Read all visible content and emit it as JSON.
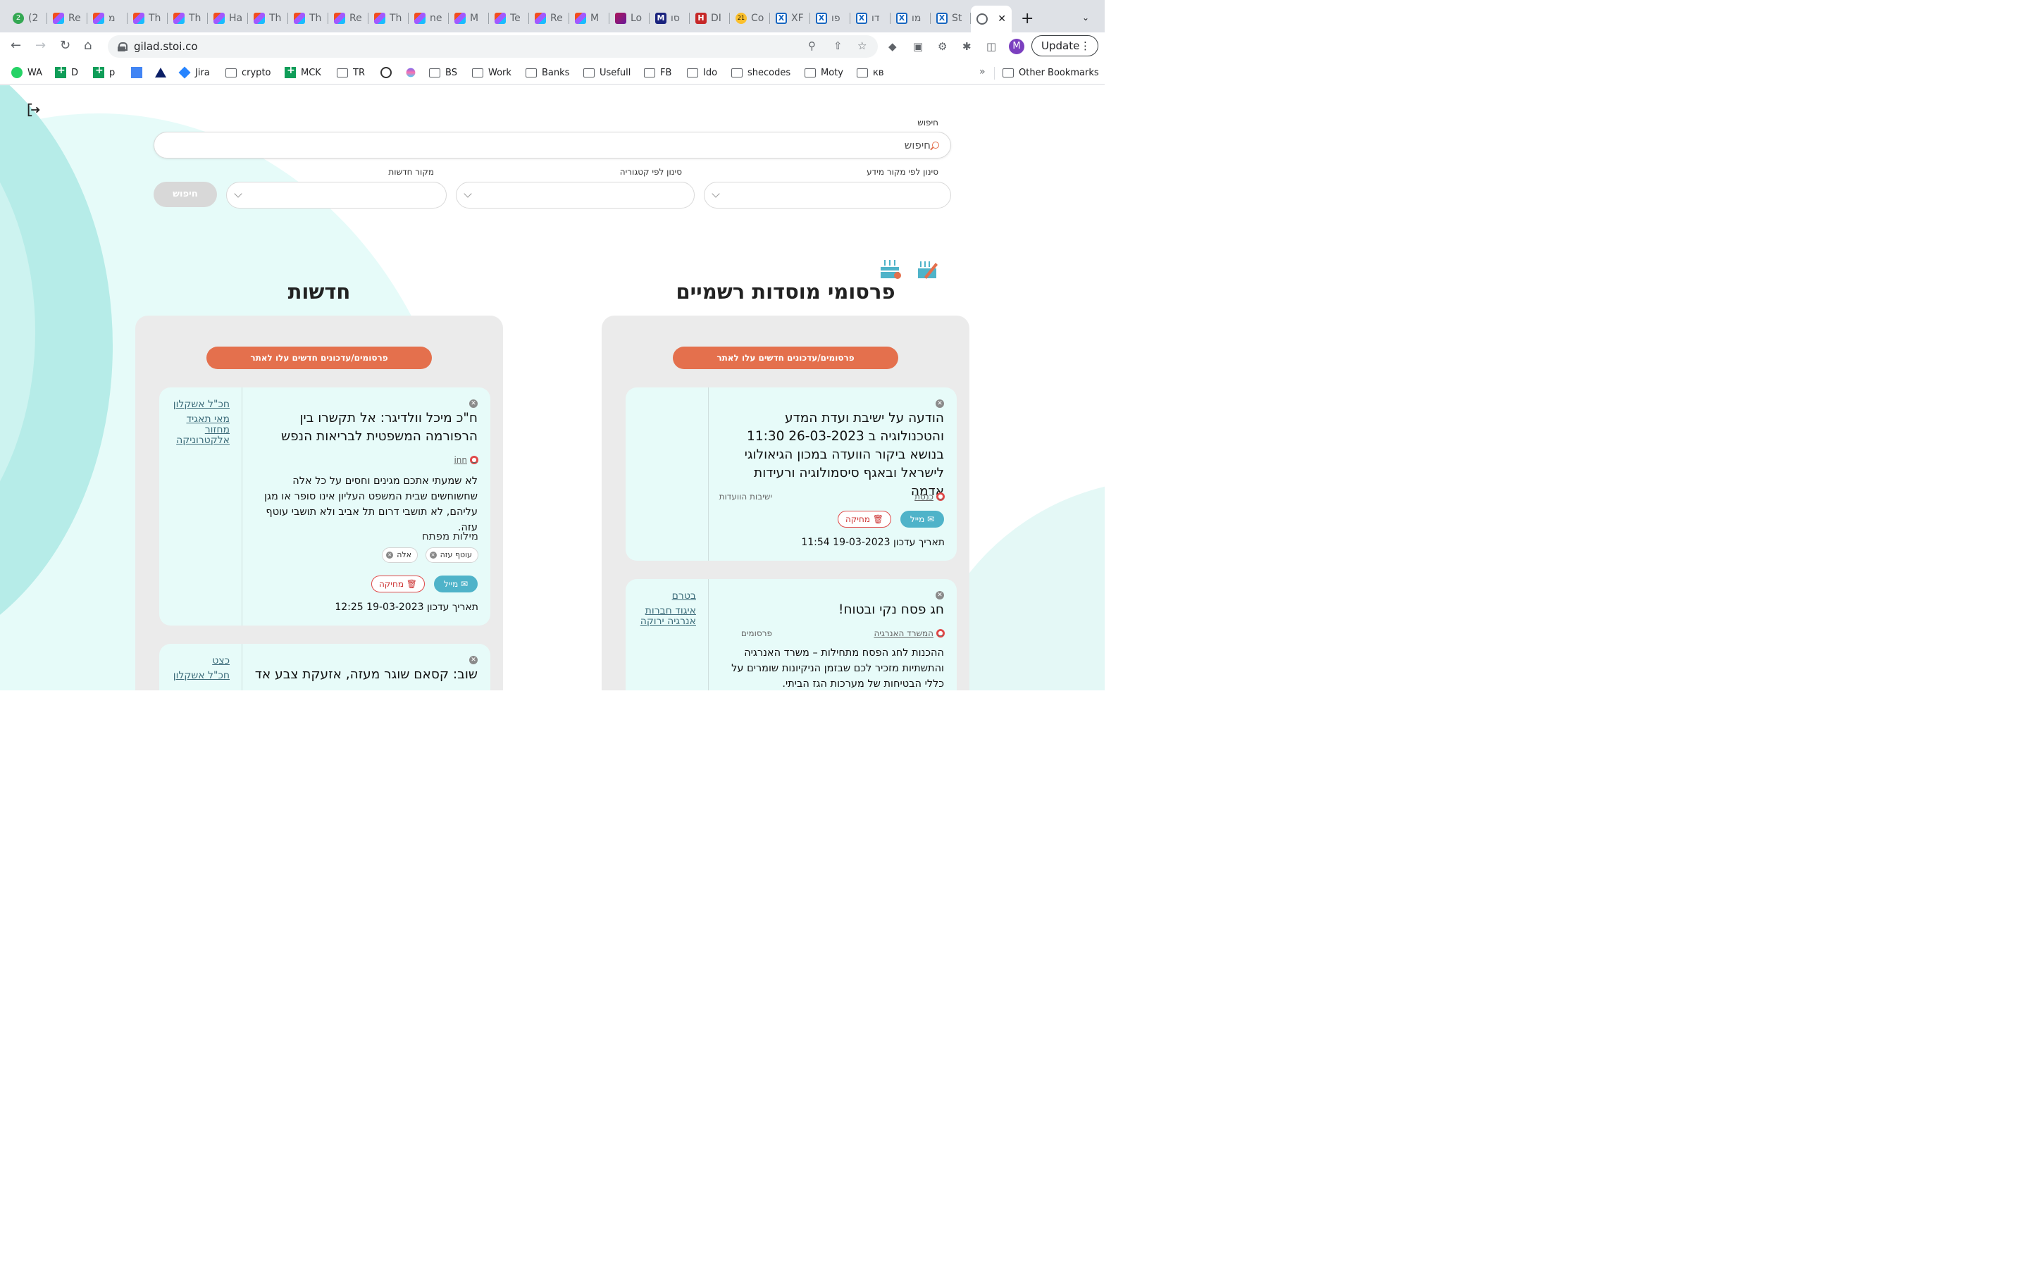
{
  "browser": {
    "tabs": [
      {
        "label": "(2",
        "icon": "whatsapp-icon"
      },
      {
        "label": "Re",
        "icon": "figma-icon"
      },
      {
        "label": "מ",
        "icon": "figma-icon"
      },
      {
        "label": "Th",
        "icon": "figma-icon"
      },
      {
        "label": "Th",
        "icon": "figma-icon"
      },
      {
        "label": "Ha",
        "icon": "figma-icon"
      },
      {
        "label": "Th",
        "icon": "figma-icon"
      },
      {
        "label": "Th",
        "icon": "figma-icon"
      },
      {
        "label": "Re",
        "icon": "figma-icon"
      },
      {
        "label": "Th",
        "icon": "figma-icon"
      },
      {
        "label": "ne",
        "icon": "figma-icon"
      },
      {
        "label": "M",
        "icon": "figma-icon"
      },
      {
        "label": "Te",
        "icon": "figma-icon"
      },
      {
        "label": "Re",
        "icon": "figma-icon"
      },
      {
        "label": "M",
        "icon": "figma-icon"
      },
      {
        "label": "Lo",
        "icon": "cube-icon"
      },
      {
        "label": "סו",
        "icon": "m-icon"
      },
      {
        "label": "DI",
        "icon": "h-icon"
      },
      {
        "label": "Co",
        "icon": "calendar-21-icon"
      },
      {
        "label": "XF",
        "icon": "x-icon"
      },
      {
        "label": "פו",
        "icon": "x-icon"
      },
      {
        "label": "דו",
        "icon": "x-icon"
      },
      {
        "label": "מו",
        "icon": "x-icon"
      },
      {
        "label": "St",
        "icon": "x-icon"
      }
    ],
    "url": "gilad.stoi.co",
    "update_label": "Update",
    "avatar_letter": "M",
    "bookmarks": [
      {
        "label": "WA",
        "icon": "whatsapp-icon"
      },
      {
        "label": "D",
        "icon": "sheets-icon"
      },
      {
        "label": "p",
        "icon": "sheets-icon"
      },
      {
        "label": "",
        "icon": "docs-icon"
      },
      {
        "label": "",
        "icon": "atlassian-icon"
      },
      {
        "label": "Jira",
        "icon": "jira-icon"
      },
      {
        "label": "crypto",
        "icon": "folder-icon"
      },
      {
        "label": "MCK",
        "icon": "sheets-icon"
      },
      {
        "label": "TR",
        "icon": "folder-icon"
      },
      {
        "label": "",
        "icon": "clock-icon"
      },
      {
        "label": "",
        "icon": "clickup-icon"
      },
      {
        "label": "BS",
        "icon": "folder-icon"
      },
      {
        "label": "Work",
        "icon": "folder-icon"
      },
      {
        "label": "Banks",
        "icon": "folder-icon"
      },
      {
        "label": "Usefull",
        "icon": "folder-icon"
      },
      {
        "label": "FB",
        "icon": "folder-icon"
      },
      {
        "label": "Ido",
        "icon": "folder-icon"
      },
      {
        "label": "shecodes",
        "icon": "folder-icon"
      },
      {
        "label": "Moty",
        "icon": "folder-icon"
      },
      {
        "label": "кв",
        "icon": "folder-icon"
      }
    ],
    "other_bookmarks": "Other Bookmarks"
  },
  "filters": {
    "search_label": "חיפוש",
    "search_placeholder": "חיפוש",
    "source_label": "סינון לפי מקור מידע",
    "category_label": "סינון לפי קטגוריה",
    "news_source_label": "מקור חדשות",
    "search_button": "חיפוש"
  },
  "colors": {
    "accent": "#e4704d",
    "mail": "#4fb3c9",
    "card_bg": "#e7fbf9"
  },
  "official": {
    "heading": "פרסומי מוסדות רשמיים",
    "new_updates_button": "פרסומים/עדכונים חדשים עלו לאתר",
    "cards": [
      {
        "title": "הודעה על ישיבת ועדת המדע והטכנולוגיה ב 26-03-2023 11:30 בנושא ביקור הוועדה במכון הגיאולוגי לישראל ובאגף סיסמולוגיה ורעידות אדמה",
        "source": "כנסת",
        "category": "ישיבות הוועדות",
        "mail": "מייל",
        "delete": "מחיקה",
        "updated": "תאריך עדכון 19-03-2023 11:54"
      },
      {
        "title": "חג פסח נקי ובטוח!",
        "source": "המשרד האנרגיה",
        "category": "פרסומים",
        "text": "ההכנות לחג הפסח מתחילות – משרד האנרגיה והתשתיות מזכיר לכם שבזמן הניקיונות שומרים על כללי הבטיחות של מערכות הגז הביתי.",
        "tags": [
          "בטרם",
          "איגוד חברות אנרגיה ירוקה"
        ]
      }
    ]
  },
  "news": {
    "heading": "חדשות",
    "new_updates_button": "פרסומים/עדכונים חדשים עלו לאתר",
    "cards": [
      {
        "title": "ח\"כ מיכל וולדיגר: אל תקשרו בין הרפורמה המשפטית לבריאות הנפש",
        "source": "inn",
        "text": "לא שמעתי אתכם מגינים וחסים על כל אלה שחשוחשים שבית המשפט העליון אינו סופר או מגן עליהם, לא תושבי דרום תל אביב ולא תושבי עוטף עזה.",
        "keywords_label": "מילות מפתח",
        "keywords": [
          "עוטף עזה",
          "אלה"
        ],
        "mail": "מייל",
        "delete": "מחיקה",
        "updated": "תאריך עדכון 19-03-2023 12:25",
        "tags": [
          "חכ\"ל אשקלון",
          "מאי תאגיד מחזור אלקטרוניקה"
        ]
      },
      {
        "title": "שוב: קסאם שוגר מעזה, אזעקת צבע אד",
        "tags": [
          "כצט",
          "חכ\"ל אשקלון"
        ]
      }
    ]
  }
}
